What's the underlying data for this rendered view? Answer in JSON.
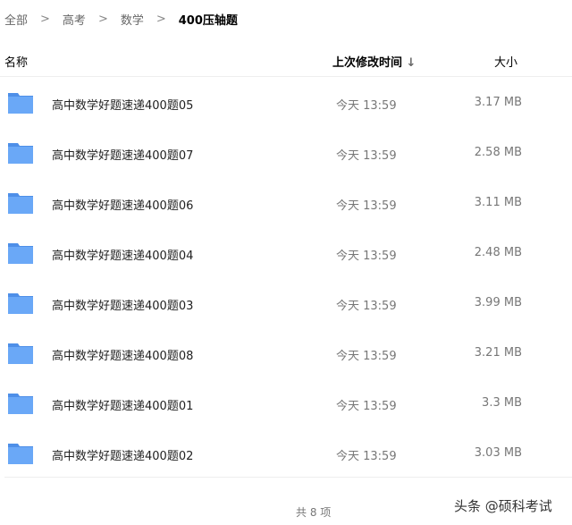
{
  "breadcrumb": [
    "全部",
    "高考",
    "数学",
    "400压轴题"
  ],
  "header": {
    "name": "名称",
    "modified": "上次修改时间",
    "sort_icon": "arrow-down-icon",
    "size": "大小"
  },
  "files": [
    {
      "name": "高中数学好题速递400题05",
      "modified": "今天 13:59",
      "size": "3.17 MB"
    },
    {
      "name": "高中数学好题速递400题07",
      "modified": "今天 13:59",
      "size": "2.58 MB"
    },
    {
      "name": "高中数学好题速递400题06",
      "modified": "今天 13:59",
      "size": "3.11 MB"
    },
    {
      "name": "高中数学好题速递400题04",
      "modified": "今天 13:59",
      "size": "2.48 MB"
    },
    {
      "name": "高中数学好题速递400题03",
      "modified": "今天 13:59",
      "size": "3.99 MB"
    },
    {
      "name": "高中数学好题速递400题08",
      "modified": "今天 13:59",
      "size": "3.21 MB"
    },
    {
      "name": "高中数学好题速递400题01",
      "modified": "今天 13:59",
      "size": "3.3 MB"
    },
    {
      "name": "高中数学好题速递400题02",
      "modified": "今天 13:59",
      "size": "3.03 MB"
    }
  ],
  "footer": {
    "count": "共 8 项"
  },
  "watermark": "头条 @硕科考试",
  "colors": {
    "folder": "#6aa8f7",
    "folder_tab": "#4e8fe8"
  }
}
